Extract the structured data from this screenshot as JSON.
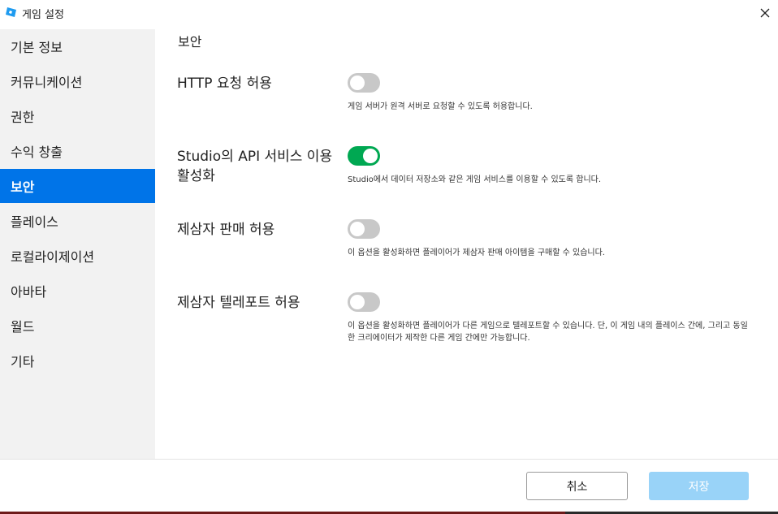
{
  "window": {
    "title": "게임 설정",
    "accent_color": "#0074e8",
    "app_icon": "roblox-studio-icon",
    "close_icon": "close-icon"
  },
  "sidebar": {
    "items": [
      {
        "label": "기본 정보",
        "active": false
      },
      {
        "label": "커뮤니케이션",
        "active": false
      },
      {
        "label": "권한",
        "active": false
      },
      {
        "label": "수익 창출",
        "active": false
      },
      {
        "label": "보안",
        "active": true
      },
      {
        "label": "플레이스",
        "active": false
      },
      {
        "label": "로컬라이제이션",
        "active": false
      },
      {
        "label": "아바타",
        "active": false
      },
      {
        "label": "월드",
        "active": false
      },
      {
        "label": "기타",
        "active": false
      }
    ]
  },
  "main": {
    "section_title": "보안",
    "settings": [
      {
        "label": "HTTP 요청 허용",
        "enabled": false,
        "description": "게임 서버가 원격 서버로 요청할 수 있도록 허용합니다."
      },
      {
        "label": "Studio의 API 서비스 이용 활성화",
        "enabled": true,
        "description": "Studio에서 데이터 저장소와 같은 게임 서비스를 이용할 수 있도록 합니다."
      },
      {
        "label": "제삼자 판매 허용",
        "enabled": false,
        "description": "이 옵션을 활성화하면 플레이어가 제삼자 판매 아이템을 구매할 수 있습니다."
      },
      {
        "label": "제삼자 텔레포트 허용",
        "enabled": false,
        "description": "이 옵션을 활성화하면 플레이어가 다른 게임으로 텔레포트할 수 있습니다. 단, 이 게임 내의 플레이스 간에, 그리고 동일한 크리에이터가 제작한 다른 게임 간에만 가능합니다."
      }
    ],
    "toggle_on_color": "#00a852",
    "toggle_off_color": "#c8c8c8"
  },
  "footer": {
    "cancel_label": "취소",
    "save_label": "저장",
    "save_color": "#99d3f8"
  }
}
